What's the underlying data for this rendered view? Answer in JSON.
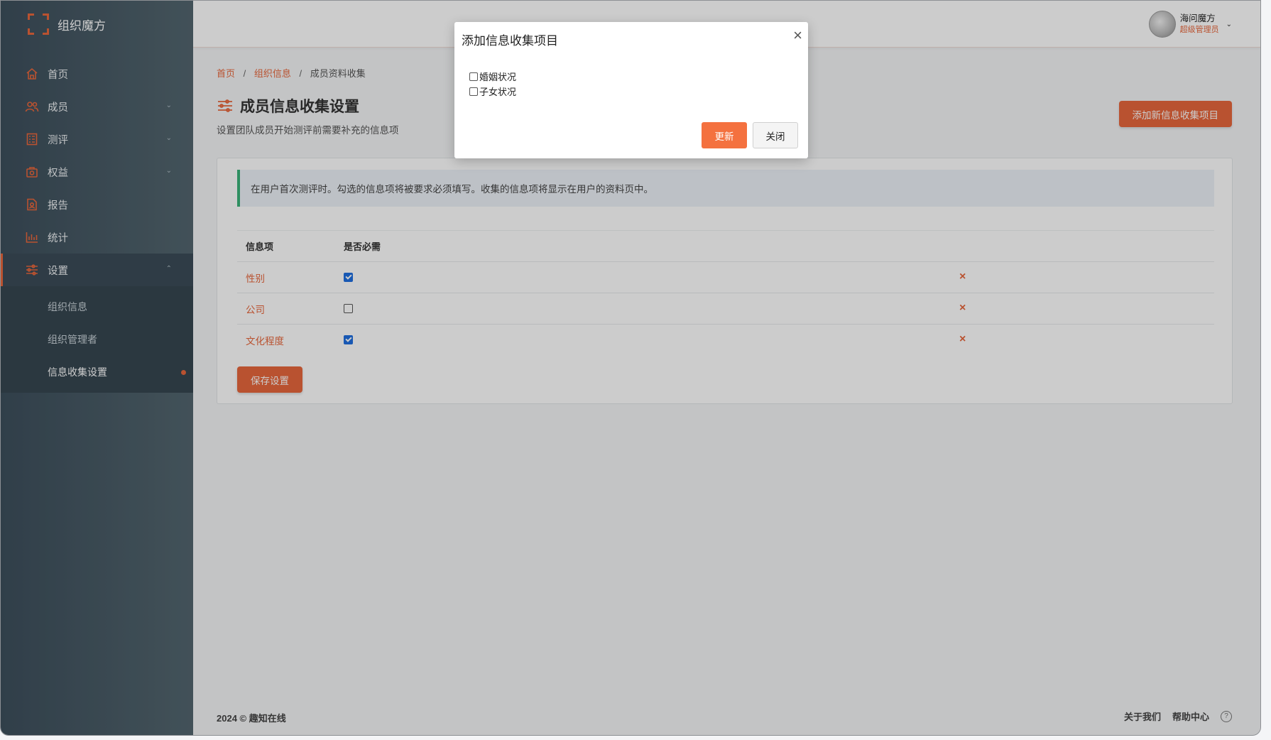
{
  "brand": {
    "name": "组织魔方"
  },
  "sidebar": {
    "items": [
      {
        "label": "首页",
        "icon": "home-icon"
      },
      {
        "label": "成员",
        "icon": "users-icon",
        "expandable": true
      },
      {
        "label": "测评",
        "icon": "assessment-icon",
        "expandable": true
      },
      {
        "label": "权益",
        "icon": "benefits-icon",
        "expandable": true
      },
      {
        "label": "报告",
        "icon": "report-icon"
      },
      {
        "label": "统计",
        "icon": "stats-icon"
      },
      {
        "label": "设置",
        "icon": "settings-icon",
        "expandable": true,
        "active": true
      }
    ],
    "subitems": [
      {
        "label": "组织信息"
      },
      {
        "label": "组织管理者"
      },
      {
        "label": "信息收集设置",
        "current": true
      }
    ]
  },
  "header": {
    "user_name": "海问魔方",
    "user_role": "超级管理员"
  },
  "breadcrumb": {
    "home": "首页",
    "parent": "组织信息",
    "current": "成员资料收集",
    "separator": "/"
  },
  "page": {
    "title": "成员信息收集设置",
    "subtitle": "设置团队成员开始测评前需要补充的信息项",
    "add_button": "添加新信息收集项目"
  },
  "notice": "在用户首次测评时。勾选的信息项将被要求必须填写。收集的信息项将显示在用户的资料页中。",
  "table": {
    "headers": [
      "信息项",
      "是否必需"
    ],
    "rows": [
      {
        "name": "性别",
        "required": true
      },
      {
        "name": "公司",
        "required": false
      },
      {
        "name": "文化程度",
        "required": true
      }
    ],
    "delete_symbol": "×"
  },
  "save_button": "保存设置",
  "footer": {
    "copyright": "2024 © 趣知在线",
    "about": "关于我们",
    "help": "帮助中心",
    "help_symbol": "?"
  },
  "modal": {
    "title": "添加信息收集项目",
    "close_symbol": "×",
    "options": [
      {
        "label": "婚姻状况",
        "checked": false
      },
      {
        "label": "子女状况",
        "checked": false
      }
    ],
    "update_button": "更新",
    "close_button": "关闭"
  },
  "colors": {
    "accent": "#e8673c",
    "sidebar_bg": "#3d4f5c",
    "checkbox_checked": "#1f6fe0",
    "notice_border": "#3bb37a"
  }
}
